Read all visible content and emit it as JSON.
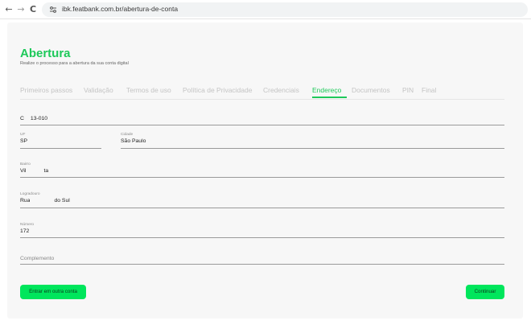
{
  "browser": {
    "back_icon": "←",
    "forward_icon": "→",
    "reload_icon": "C",
    "url": "ibk.featbank.com.br/abertura-de-conta"
  },
  "header": {
    "title": "Abertura",
    "subtitle": "Realize o processo para a abertura da sua conta digital"
  },
  "tabs": [
    {
      "label": "Primeiros passos",
      "active": false
    },
    {
      "label": "Validação",
      "active": false
    },
    {
      "label": "Termos de uso",
      "active": false
    },
    {
      "label": "Política de Privacidade",
      "active": false
    },
    {
      "label": "Credenciais",
      "active": false
    },
    {
      "label": "Endereço",
      "active": true
    },
    {
      "label": "Documentos",
      "active": false
    },
    {
      "label": "PIN",
      "active": false
    },
    {
      "label": "Final",
      "active": false
    }
  ],
  "form": {
    "cep": {
      "value_start": "C",
      "value_end": "13-010"
    },
    "uf": {
      "label": "UF",
      "value": "SP"
    },
    "cidade": {
      "label": "Cidade",
      "value": "São Paulo"
    },
    "bairro": {
      "label": "Bairro",
      "value_start": "Vil",
      "value_end": "ta"
    },
    "logradouro": {
      "label": "Logradouro",
      "value_start": "Rua",
      "value_end": "do Sul"
    },
    "numero": {
      "label": "Número",
      "value": "172"
    },
    "complemento": {
      "placeholder": "Complemento"
    }
  },
  "buttons": {
    "secondary": "Entrar em outra conta",
    "primary": "Continuar"
  },
  "colors": {
    "accent": "#1ec95a",
    "button": "#00e65c"
  }
}
